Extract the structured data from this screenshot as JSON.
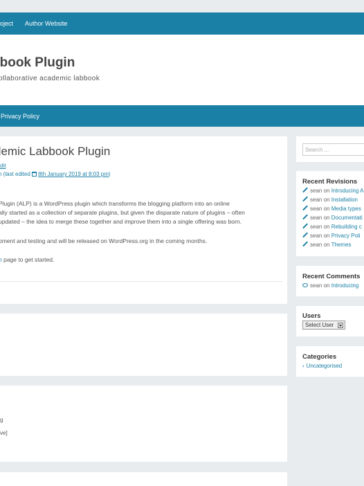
{
  "topbar": {
    "links": [
      "roject",
      "Author Website"
    ]
  },
  "header": {
    "title": "bbook Plugin",
    "description": "ollaborative academic labbook"
  },
  "navbar": {
    "links": [
      "Privacy Policy"
    ]
  },
  "post": {
    "title": "demic Labbook Plugin",
    "meta_edit": "dit",
    "meta_prefix": "n (last edited",
    "meta_date": "8th January 2019 at 8:03 pm",
    "meta_suffix": ")",
    "para1_line1": "Plugin (ALP) is a WordPress plugin which transforms the blogging platform into an online",
    "para1_line2": "ally started as a collection of separate plugins, but given the disparate nature of plugins – often",
    "para1_line3": "updated – the idea to merge these together and improve them into a single offering was born.",
    "para2": "pment and testing and will be released on WordPress.org in the coming months.",
    "para3_link": "n",
    "para3_text": " page to get started."
  },
  "card3": {
    "line1": "g",
    "line2": "ve]"
  },
  "sidebar": {
    "search_placeholder": "Search ...",
    "recent_revisions": {
      "title": "Recent Revisions",
      "items": [
        {
          "user": "sean",
          "on": "on",
          "target": "Introducing A"
        },
        {
          "user": "sean",
          "on": "on",
          "target": "Installation"
        },
        {
          "user": "sean",
          "on": "on",
          "target": "Media types"
        },
        {
          "user": "sean",
          "on": "on",
          "target": "Documentati"
        },
        {
          "user": "sean",
          "on": "on",
          "target": "Rebuilding c"
        },
        {
          "user": "sean",
          "on": "on",
          "target": "Privacy Poli"
        },
        {
          "user": "sean",
          "on": "on",
          "target": "Themes"
        }
      ]
    },
    "recent_comments": {
      "title": "Recent Comments",
      "items": [
        {
          "user": "sean",
          "on": "on",
          "target": "Introducing"
        }
      ]
    },
    "users": {
      "title": "Users",
      "select_value": "Select User"
    },
    "categories": {
      "title": "Categories",
      "items": [
        "Uncategorised"
      ]
    }
  },
  "colors": {
    "accent": "#1b80a6",
    "background": "#e9ecef"
  },
  "icons": [
    "pencil-icon",
    "comment-bubble-icon",
    "calendar-icon",
    "chevron-right-icon",
    "dropdown-arrow-icon"
  ]
}
